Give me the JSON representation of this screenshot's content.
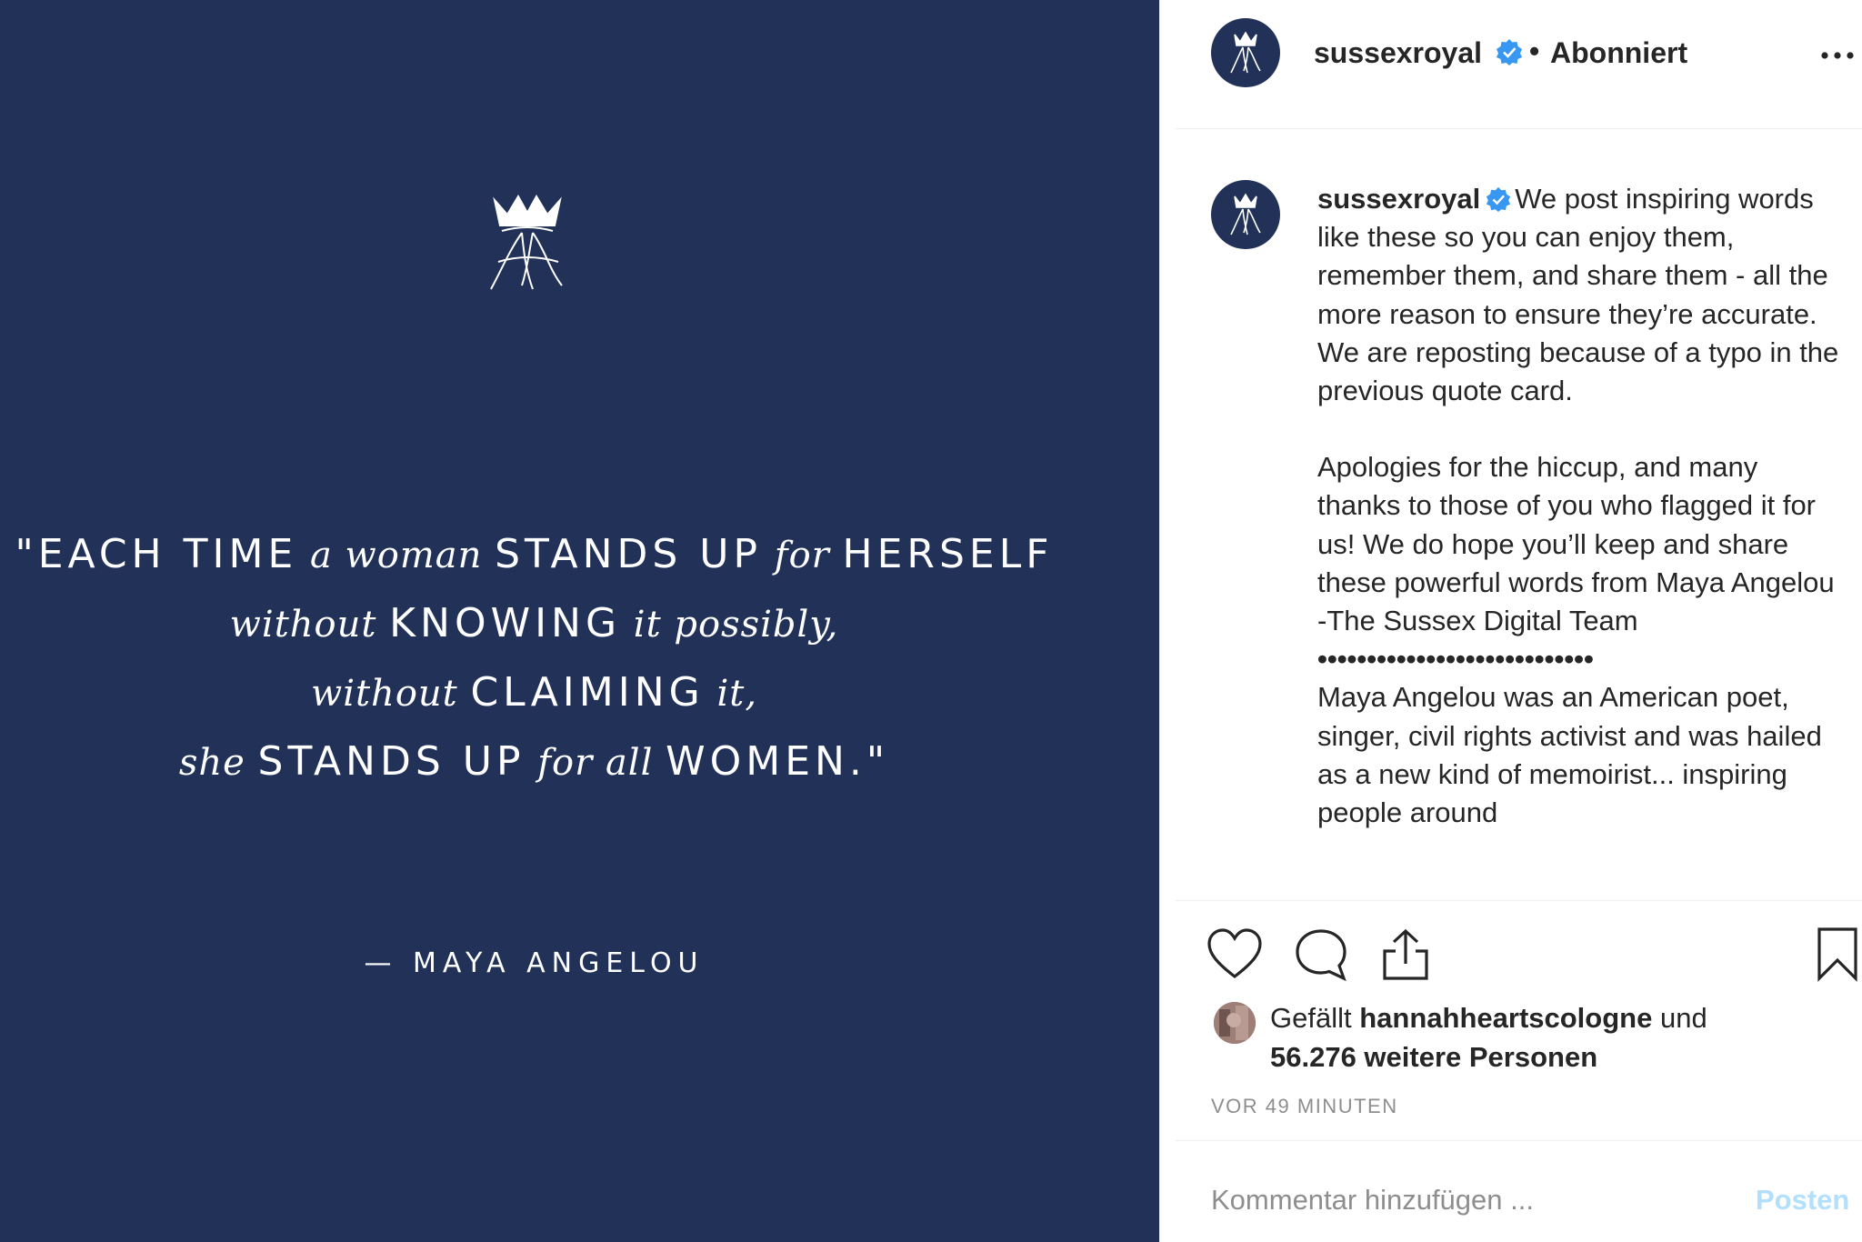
{
  "card": {
    "quote_lines": [
      [
        {
          "t": "\"EACH TIME",
          "s": "caps"
        },
        {
          "t": " a woman ",
          "s": "ital"
        },
        {
          "t": "STANDS UP",
          "s": "caps"
        },
        {
          "t": " for ",
          "s": "ital"
        },
        {
          "t": "HERSELF",
          "s": "caps"
        }
      ],
      [
        {
          "t": "without ",
          "s": "ital"
        },
        {
          "t": "KNOWING",
          "s": "caps"
        },
        {
          "t": " it possibly,",
          "s": "ital"
        }
      ],
      [
        {
          "t": "without ",
          "s": "ital"
        },
        {
          "t": "CLAIMING",
          "s": "caps"
        },
        {
          "t": " it,",
          "s": "ital"
        }
      ],
      [
        {
          "t": "she ",
          "s": "ital"
        },
        {
          "t": "STANDS UP",
          "s": "caps"
        },
        {
          "t": " for all ",
          "s": "ital"
        },
        {
          "t": "WOMEN.\"",
          "s": "caps"
        }
      ]
    ],
    "author": "— MAYA ANGELOU",
    "bg_color": "#213158"
  },
  "header": {
    "username": "sussexroyal",
    "dot": "•",
    "follow_status": "Abonniert",
    "avatar_icon": "crown-monogram-icon",
    "verified_icon": "verified-badge-icon",
    "more_icon": "more-options-icon"
  },
  "caption": {
    "username": "sussexroyal",
    "intro": "We post inspiring words like these so you can enjoy them, remember them, and share them - all the more reason to ensure they’re accurate. We are reposting because of a typo in the previous quote card.",
    "para2": "Apologies for the hiccup, and many thanks to those of you who flagged it for us! We do hope you’ll keep and share these powerful words from Maya Angelou",
    "signoff": "-The Sussex Digital Team",
    "dots": "••••••••••••••••••••••••••••",
    "para3": "Maya Angelou was an American poet, singer, civil rights activist and was hailed as a new kind of memoirist... inspiring people around"
  },
  "actions": {
    "like_icon": "heart-icon",
    "comment_icon": "comment-icon",
    "share_icon": "share-icon",
    "save_icon": "bookmark-icon"
  },
  "likes": {
    "prefix": "Gefällt",
    "user": "hannahheartscologne",
    "conj": "und",
    "others": "56.276 weitere Personen"
  },
  "time": "VOR 49 MINUTEN",
  "comment": {
    "placeholder": "Kommentar hinzufügen ...",
    "post_label": "Posten"
  },
  "colors": {
    "verified": "#3897f0",
    "post_button_disabled": "#b2dffc",
    "muted_text": "#8e8e8e"
  }
}
